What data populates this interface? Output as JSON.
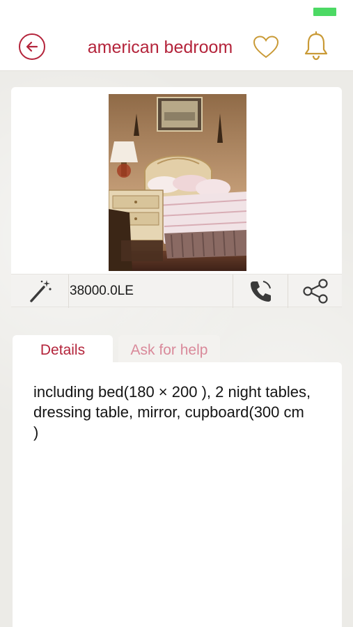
{
  "header": {
    "title": "american bedroom",
    "back_icon": "back-arrow-icon",
    "favorite_icon": "heart-icon",
    "notification_icon": "bell-icon"
  },
  "product": {
    "price": "38000.0LE",
    "image_alt": "American classic bedroom set with ornate bed and night table",
    "actions": [
      "magic-wand-icon",
      "phone-icon",
      "share-icon"
    ]
  },
  "tabs": [
    {
      "label": "Details",
      "active": true
    },
    {
      "label": "Ask for help",
      "active": false
    }
  ],
  "details": {
    "text": "including bed(180 × 200 ), 2 night tables, dressing table, mirror, cupboard(300 cm )"
  },
  "colors": {
    "accent": "#b4243b",
    "gold_icon": "#c99a36",
    "battery": "#4cd964"
  }
}
